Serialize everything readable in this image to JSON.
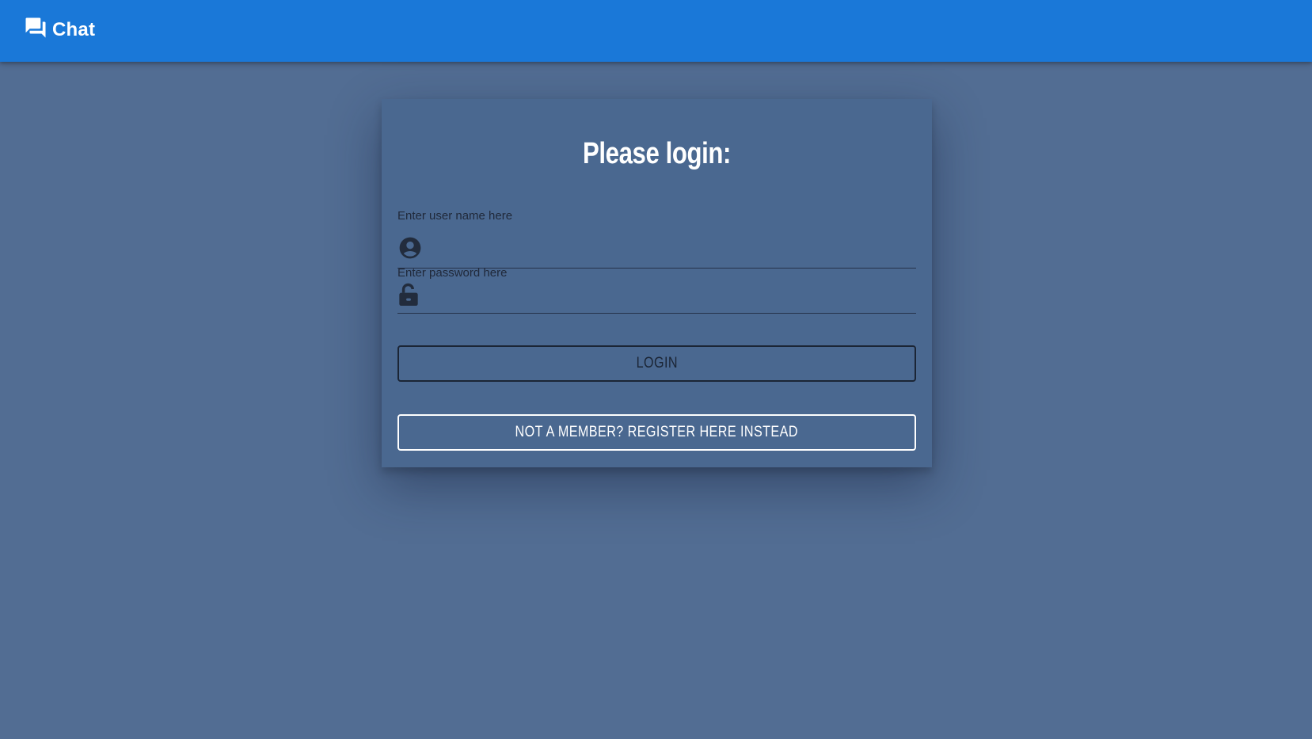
{
  "app": {
    "title": "Chat",
    "icon": "chat-bubbles-icon"
  },
  "colors": {
    "appbar": "#1a78d8",
    "background": "#526d93",
    "card": "#4a6890",
    "heading": "#ffffff",
    "label": "#20293a",
    "login_button_border": "#1b2535",
    "register_button_border": "#ffffff"
  },
  "login": {
    "heading": "Please login:",
    "username": {
      "label": "Enter user name here",
      "value": "",
      "icon": "account-circle-icon"
    },
    "password": {
      "label": "Enter password here",
      "value": "",
      "icon": "lock-open-icon"
    },
    "login_button": "LOGIN",
    "register_button": "NOT A MEMBER? REGISTER HERE INSTEAD"
  }
}
